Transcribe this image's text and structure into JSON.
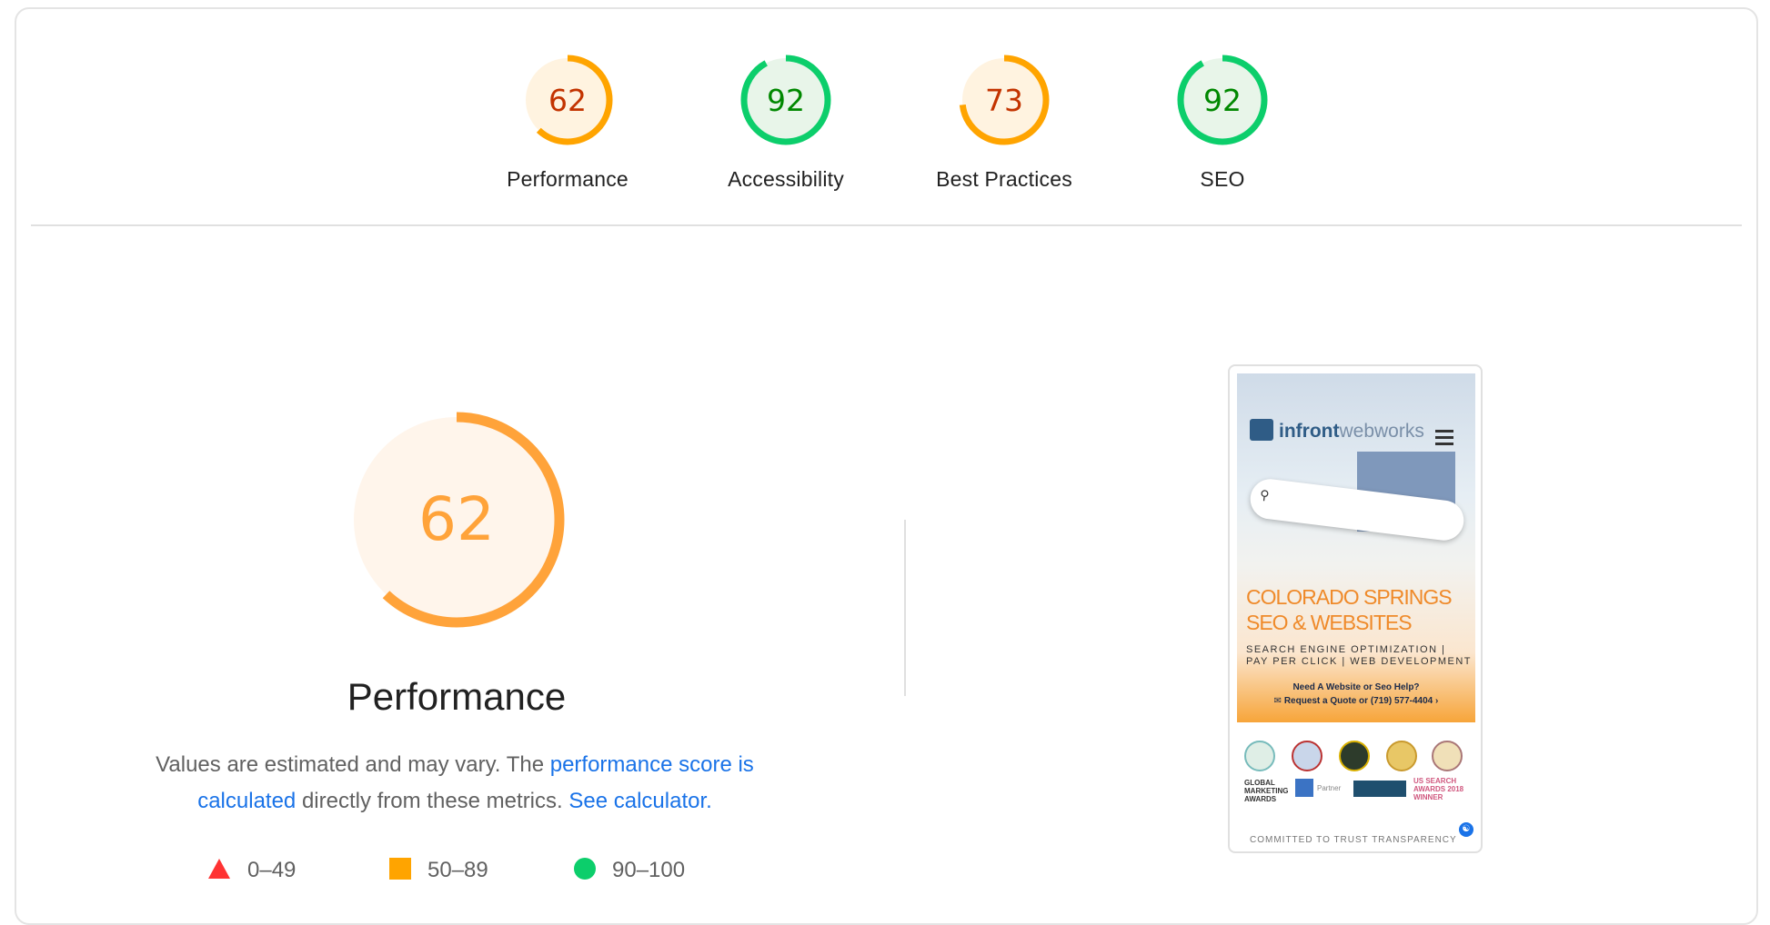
{
  "categories": [
    {
      "label": "Performance",
      "score": "62",
      "value": 62,
      "color": "#ffa400",
      "text_color": "#c33300",
      "bg": "#fff3e0"
    },
    {
      "label": "Accessibility",
      "score": "92",
      "value": 92,
      "color": "#0cce6b",
      "text_color": "#008800",
      "bg": "#e8f5e9"
    },
    {
      "label": "Best Practices",
      "score": "73",
      "value": 73,
      "color": "#ffa400",
      "text_color": "#c33300",
      "bg": "#fff3e0"
    },
    {
      "label": "SEO",
      "score": "92",
      "value": 92,
      "color": "#0cce6b",
      "text_color": "#008800",
      "bg": "#e8f5e9"
    }
  ],
  "main": {
    "score": "62",
    "value": 62,
    "title": "Performance",
    "color": "#ffa33a",
    "bg": "#fff5eb",
    "desc_pre": "Values are estimated and may vary. The ",
    "desc_link1": "performance score is calculated",
    "desc_mid": " directly from these metrics. ",
    "desc_link2": "See calculator."
  },
  "legend": [
    {
      "shape": "triangle",
      "color": "#ff3333",
      "label": "0–49"
    },
    {
      "shape": "square",
      "color": "#ffa400",
      "label": "50–89"
    },
    {
      "shape": "circle",
      "color": "#0cce6b",
      "label": "90–100"
    }
  ],
  "screenshot": {
    "logo_brand": "infront",
    "logo_rest": "webworks",
    "headline_1": "COLORADO SPRINGS",
    "headline_2": "SEO & WEBSITES",
    "sub_1": "SEARCH ENGINE OPTIMIZATION |",
    "sub_2": "PAY PER CLICK | WEB DEVELOPMENT",
    "cta_1": "Need A Website or Seo Help?",
    "cta_2": "✉ Request a Quote or (719) 577-4404 ›",
    "badge_text_1": "GLOBAL MARKETING AWARDS",
    "badge_text_2": "Partner",
    "badge_text_3": "US SEARCH AWARDS 2018 WINNER",
    "footer_cut": "COMMITTED TO TRUST TRANSPARENCY"
  }
}
